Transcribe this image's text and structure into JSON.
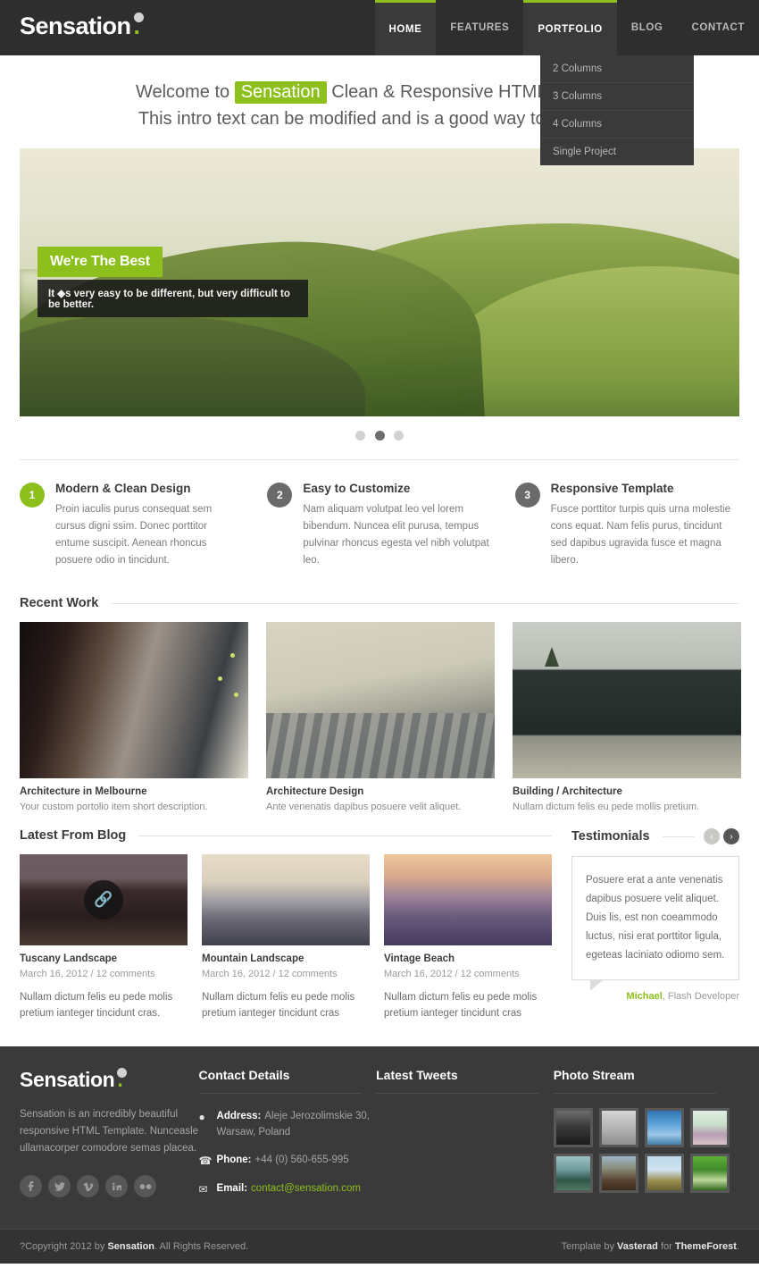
{
  "site": {
    "logo_text": "Sensation",
    "logo_dot": "."
  },
  "nav": {
    "items": [
      {
        "label": "HOME",
        "state": "active"
      },
      {
        "label": "FEATURES",
        "state": "normal"
      },
      {
        "label": "PORTFOLIO",
        "state": "open"
      },
      {
        "label": "BLOG",
        "state": "normal"
      },
      {
        "label": "CONTACT",
        "state": "normal"
      }
    ],
    "dropdown": {
      "parent": "PORTFOLIO",
      "items": [
        "2 Columns",
        "3 Columns",
        "4 Columns",
        "Single Project"
      ]
    }
  },
  "intro": {
    "line1_before": "Welcome to ",
    "line1_highlight": "Sensation",
    "line1_after": " Clean & Responsive HTML Template",
    "line2": "This intro text can be modified and is a good way to say hello"
  },
  "slider": {
    "caption_title": "We're The Best",
    "caption_sub": "It ◆s very easy to be different, but very difficult to be better.",
    "dots": [
      {
        "active": false
      },
      {
        "active": true
      },
      {
        "active": false
      }
    ]
  },
  "features": [
    {
      "number": "1",
      "color": "green",
      "title": "Modern & Clean Design",
      "desc": "Proin iaculis purus consequat sem cursus digni ssim. Donec porttitor entume suscipit. Aenean rhoncus posuere odio in tincidunt."
    },
    {
      "number": "2",
      "color": "gray",
      "title": "Easy to Customize",
      "desc": "Nam aliquam volutpat leo vel lorem bibendum. Nuncea elit purusa, tempus pulvinar rhoncus egesta vel nibh volutpat leo."
    },
    {
      "number": "3",
      "color": "gray",
      "title": "Responsive Template",
      "desc": "Fusce porttitor turpis quis urna molestie cons equat. Nam felis purus, tincidunt sed dapibus ugravida fusce et magna libero."
    }
  ],
  "recent_work": {
    "heading": "Recent Work",
    "items": [
      {
        "title": "Architecture in Melbourne",
        "desc": "Your custom portolio item short description."
      },
      {
        "title": "Architecture Design",
        "desc": "Ante venenatis dapibus posuere velit aliquet."
      },
      {
        "title": "Building / Architecture",
        "desc": "Nullam dictum felis eu pede mollis pretium."
      }
    ]
  },
  "blog": {
    "heading": "Latest From Blog",
    "posts": [
      {
        "title": "Tuscany Landscape",
        "meta": "March 16, 2012 / 12 comments",
        "excerpt": "Nullam dictum felis eu pede molis pretium ianteger tincidunt cras.",
        "has_link_icon": true
      },
      {
        "title": "Mountain Landscape",
        "meta": "March 16, 2012 / 12 comments",
        "excerpt": "Nullam dictum felis eu pede molis pretium ianteger tincidunt cras",
        "has_link_icon": false
      },
      {
        "title": "Vintage Beach",
        "meta": "March 16, 2012 / 12 comments",
        "excerpt": "Nullam dictum felis eu pede molis pretium ianteger tincidunt cras",
        "has_link_icon": false
      }
    ]
  },
  "testimonials": {
    "heading": "Testimonials",
    "prev_label": "‹",
    "next_label": "›",
    "text": "Posuere erat a ante venenatis dapibus posuere velit aliquet. Duis lis, est non coeammodo luctus, nisi erat porttitor ligula, egeteas laciniato odiomo sem.",
    "author_name": "Michael",
    "author_role": ", Flash Developer"
  },
  "footer": {
    "logo_text": "Sensation",
    "logo_dot": ".",
    "about": "Sensation is an incredibly beautiful responsive HTML Template. Nunceasle ullamacorper comodore semas placea.",
    "socials": [
      {
        "name": "facebook-icon",
        "glyph": "f"
      },
      {
        "name": "twitter-icon",
        "glyph": "✉"
      },
      {
        "name": "vimeo-icon",
        "glyph": "v"
      },
      {
        "name": "linkedin-icon",
        "glyph": "in"
      },
      {
        "name": "flickr-icon",
        "glyph": "••"
      }
    ],
    "contact": {
      "heading": "Contact Details",
      "address_label": "Address:",
      "address_value": "Aleje Jerozolimskie 30, Warsaw, Poland",
      "phone_label": "Phone:",
      "phone_value": "+44 (0) 560-655-995",
      "email_label": "Email:",
      "email_value": "contact@sensation.com"
    },
    "tweets": {
      "heading": "Latest Tweets",
      "items": []
    },
    "photo_stream": {
      "heading": "Photo Stream",
      "count": 8
    }
  },
  "copyright": {
    "left_prefix": "?Copyright 2012 by ",
    "left_brand": "Sensation",
    "left_suffix": ". All Rights Reserved.",
    "right_prefix": "Template by ",
    "right_brand1": "Vasterad",
    "right_mid": " for ",
    "right_brand2": "ThemeForest",
    "right_suffix": "."
  },
  "colors": {
    "accent_green": "#8dbf1d",
    "header_dark": "#2e2e2e",
    "footer_dark": "#3a3a3a",
    "copyright_dark": "#333333"
  }
}
